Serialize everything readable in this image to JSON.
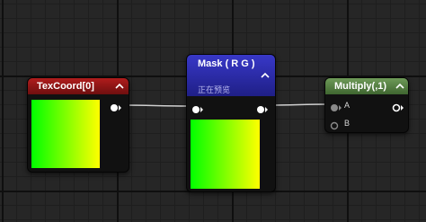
{
  "colors": {
    "canvas": "#262626",
    "texcoord_header": "#8a1515",
    "mask_header": "#2a2aa0",
    "multiply_header": "#4f7a3c",
    "wire": "#d0d0d0"
  },
  "nodes": {
    "texcoord": {
      "title": "TexCoord[0]",
      "icon": "chevron-up-icon"
    },
    "mask": {
      "title": "Mask ( R G )",
      "subtitle": "正在预览",
      "icon": "chevron-up-icon"
    },
    "multiply": {
      "title": "Multiply(,1)",
      "icon": "chevron-up-icon",
      "inputs": [
        "A",
        "B"
      ]
    }
  }
}
